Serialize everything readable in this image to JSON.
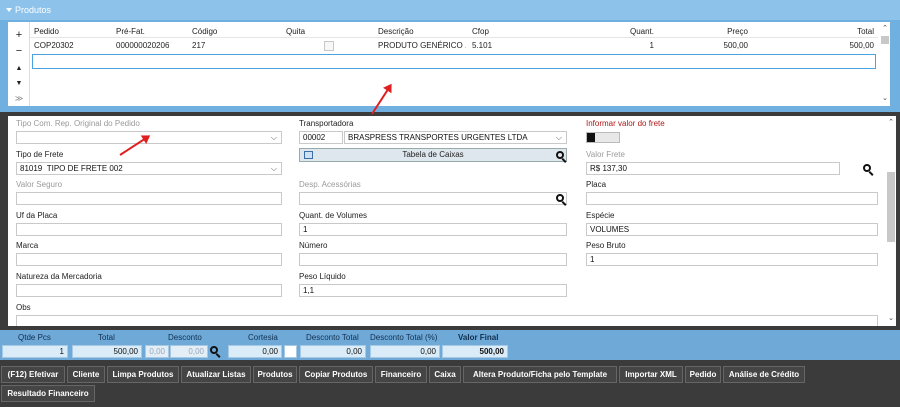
{
  "products": {
    "title": "Produtos",
    "side_buttons": [
      "+",
      "−",
      "▲",
      "▼",
      "≫"
    ],
    "columns": [
      "Pedido",
      "Pré-Fat.",
      "Código",
      "Quita",
      "Descrição",
      "Cfop",
      "Quant.",
      "Preço",
      "Total"
    ],
    "rows": [
      {
        "pedido": "COP20302",
        "pre_fat": "000000020206",
        "codigo": "217",
        "descricao": "PRODUTO GENÉRICO ...",
        "cfop": "5.101",
        "quant": "1",
        "preco": "500,00",
        "total": "500,00"
      }
    ]
  },
  "form": {
    "tipo_com_label": "Tipo Com. Rep. Original do Pedido",
    "transportadora_label": "Transportadora",
    "transportadora_code": "00002",
    "transportadora_name": "BRASPRESS TRANSPORTES URGENTES LTDA",
    "informar_frete_label": "Informar valor do frete",
    "informar_frete_on": false,
    "tipo_frete_label": "Tipo de Frete",
    "tipo_frete_code": "81019",
    "tipo_frete_value": "TIPO DE FRETE 002",
    "tabela_caixas_label": "Tabela de Caixas",
    "valor_frete_label": "Valor Frete",
    "valor_frete_value": "R$ 137,30",
    "valor_seguro_label": "Valor Seguro",
    "desp_acessorias_label": "Desp. Acessórias",
    "placa_label": "Placa",
    "uf_placa_label": "Uf da Placa",
    "quant_volumes_label": "Quant. de Volumes",
    "quant_volumes_value": "1",
    "especie_label": "Espécie",
    "especie_value": "VOLUMES",
    "marca_label": "Marca",
    "numero_label": "Número",
    "peso_bruto_label": "Peso Bruto",
    "peso_bruto_value": "1",
    "natureza_label": "Natureza da Mercadoria",
    "peso_liquido_label": "Peso Líquido",
    "peso_liquido_value": "1,1",
    "obs_label": "Obs"
  },
  "totals": {
    "qtde_pcs_label": "Qtde Pcs",
    "qtde_pcs_value": "1",
    "total_label": "Total",
    "total_value": "500,00",
    "desconto_label": "Desconto",
    "desconto_value1": "0,00",
    "desconto_value2": "0,00",
    "cortesia_label": "Cortesia",
    "cortesia_value": "0,00",
    "desconto_total_label": "Desconto Total",
    "desconto_total_value": "0,00",
    "desconto_total_pct_label": "Desconto Total (%)",
    "desconto_total_pct_value": "0,00",
    "valor_final_label": "Valor Final",
    "valor_final_value": "500,00"
  },
  "buttons": [
    "(F12) Efetivar",
    "Cliente",
    "Limpa Produtos",
    "Atualizar Listas",
    "Produtos",
    "Copiar Produtos",
    "Financeiro",
    "Caixa",
    "Altera Produto/Ficha pelo Template",
    "Importar XML",
    "Pedido",
    "Análise de Crédito",
    "Resultado Financeiro"
  ],
  "colors": {
    "accent_blue": "#6fb0e0",
    "arrow_red": "#e02020",
    "label_red": "#b01616"
  }
}
